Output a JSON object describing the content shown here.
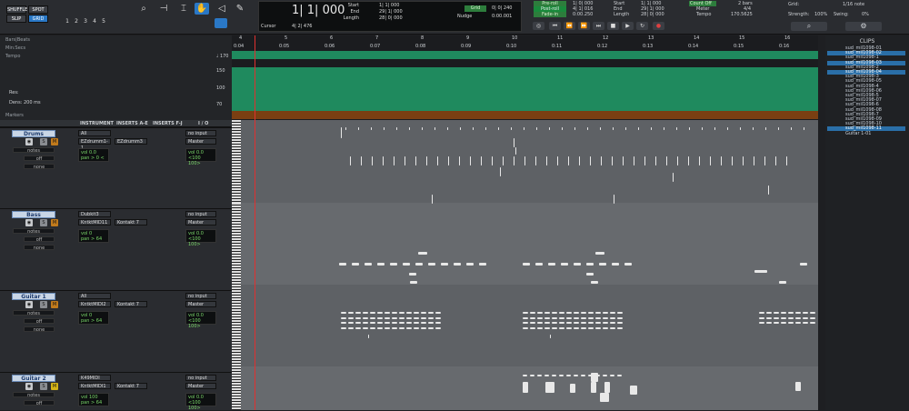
{
  "modes": {
    "shuffle": "SHUFFLE",
    "spot": "SPOT",
    "slip": "SLIP",
    "grid": "GRID"
  },
  "zoom_presets": [
    "1",
    "2",
    "3",
    "4",
    "5"
  ],
  "counter": {
    "main": "1| 1| 000",
    "start": "1| 1| 000",
    "end": "29| 1| 000",
    "length": "28| 0| 000",
    "start_label": "Start",
    "end_label": "End",
    "length_label": "Length"
  },
  "cursor": {
    "label": "Cursor",
    "value": "4| 2| 476"
  },
  "nudge": {
    "label": "Nudge",
    "value": "0| 0| 240",
    "value2": "0:00.001"
  },
  "grid_btn": "Grid",
  "preroll": {
    "pre": "Pre-roll",
    "post": "Post-roll",
    "fade": "Fade-in",
    "pre_v": "1| 0| 000",
    "post_v": "4| 1| 016",
    "fade_v": "0:00.250"
  },
  "sel2": {
    "start": "1| 1| 000",
    "end": "29| 1| 000",
    "length": "28| 0| 000",
    "start_label": "Start",
    "end_label": "End",
    "length_label": "Length"
  },
  "countoff": {
    "label": "Count Off",
    "bars": "2 bars",
    "meter_label": "Meter",
    "meter": "4/4",
    "tempo_label": "Tempo",
    "tempo": "170.5625"
  },
  "gridinfo": {
    "label": "Grid:",
    "value": "1/16 note",
    "strength_label": "Strength:",
    "strength": "100%",
    "swing_label": "Swing:",
    "swing": "0%"
  },
  "ruler": {
    "bars_beats": "Bars|Beats",
    "min_secs": "Min:Secs",
    "tempo": "Tempo",
    "markers": "Markers",
    "bpm_label": "♩ 170",
    "tempo_hi": "150",
    "tempo_mid": "100",
    "tempo_lo": "70",
    "res_label": "Res:",
    "dens_label": "Dens:",
    "dens": "200 ms"
  },
  "bars": [
    "4",
    "5",
    "6",
    "7",
    "8",
    "9",
    "10",
    "11",
    "12",
    "13",
    "14",
    "15",
    "16"
  ],
  "secs": [
    "0:04",
    "0:05",
    "0:06",
    "0:07",
    "0:08",
    "0:09",
    "0:10",
    "0:11",
    "0:12",
    "0:13",
    "0:14",
    "0:15",
    "0:16"
  ],
  "columns": {
    "instrument": "INSTRUMENT",
    "inserts_ae": "INSERTS A-E",
    "inserts_fj": "INSERTS F-J",
    "io": "I / O"
  },
  "tracks": [
    {
      "name": "Drums",
      "instr": "All",
      "instr2": "EZdrumm1-1",
      "insert": "EZdrumm3",
      "io_in": "no input",
      "io_out": "Master",
      "view": "notes",
      "auto": "off",
      "grp": "none",
      "vol": "vol  0.0",
      "pan": "pan > 0 <",
      "vol2": "vol  0.0",
      "pan2": "<100  100>",
      "mute_yellow": false
    },
    {
      "name": "Bass",
      "instr": "Dubkit3",
      "instr2": "KntktMID11",
      "insert": "Kontakt 7",
      "io_in": "no input",
      "io_out": "Master",
      "view": "notes",
      "auto": "off",
      "grp": "none",
      "vol": "vol   0",
      "pan": "pan > 64",
      "vol2": "vol  0.0",
      "pan2": "<100  100>",
      "mute_yellow": false
    },
    {
      "name": "Guitar 1",
      "instr": "All",
      "instr2": "KntktMIDI2",
      "insert": "Kontakt 7",
      "io_in": "no input",
      "io_out": "Master",
      "view": "notes",
      "auto": "off",
      "grp": "none",
      "vol": "vol   0",
      "pan": "pan > 64",
      "vol2": "vol  0.0",
      "pan2": "<100  100>",
      "mute_yellow": false
    },
    {
      "name": "Guitar 2",
      "instr": "K49MIDI",
      "instr2": "KntktMIDI1",
      "insert": "Kontakt 7",
      "io_in": "no input",
      "io_out": "Master",
      "view": "notes",
      "auto": "off",
      "grp": "none",
      "vol": "vol  100",
      "pan": "pan > 64",
      "vol2": "vol  0.0",
      "pan2": "<100  100>",
      "mute_yellow": true
    }
  ],
  "clips_title": "CLIPS",
  "clips": [
    {
      "name": "sud_mil1098-01",
      "sel": false
    },
    {
      "name": "sud_mil1098-02",
      "sel": true
    },
    {
      "name": "sud_mil1098-1",
      "sel": false
    },
    {
      "name": "sud_mil1098-03",
      "sel": true
    },
    {
      "name": "sud_mil1098-2",
      "sel": false
    },
    {
      "name": "sud_mil1098-04",
      "sel": true
    },
    {
      "name": "sud_mil1098-3",
      "sel": false
    },
    {
      "name": "sud_mil1098-05",
      "sel": false
    },
    {
      "name": "sud_mil1098-4",
      "sel": false
    },
    {
      "name": "sud_mil1098-06",
      "sel": false
    },
    {
      "name": "sud_mil1098-5",
      "sel": false
    },
    {
      "name": "sud_mil1098-07",
      "sel": false
    },
    {
      "name": "sud_mil1098-6",
      "sel": false
    },
    {
      "name": "sud_mil1098-08",
      "sel": false
    },
    {
      "name": "sud_mil1098-7",
      "sel": false
    },
    {
      "name": "sud_mil1098-09",
      "sel": false
    },
    {
      "name": "sud_mil1098-10",
      "sel": false
    },
    {
      "name": "sud_mil1098-11",
      "sel": true
    },
    {
      "name": "Guitar 1-01",
      "sel": false
    }
  ]
}
